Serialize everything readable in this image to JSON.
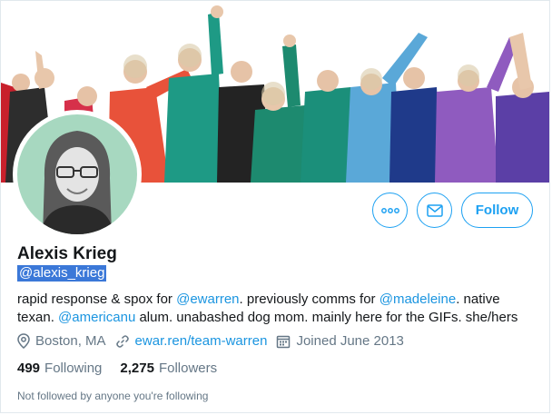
{
  "profile": {
    "name": "Alexis Krieg",
    "handle": "@alexis_krieg",
    "bio": {
      "t1": "rapid response & spox for ",
      "m1": "@ewarren",
      "t2": ". previously comms for ",
      "m2": "@madeleine",
      "t3": ". native texan. ",
      "m3": "@americanu",
      "t4": " alum. unabashed dog mom. mainly here for the GIFs. she/hers"
    },
    "location": "Boston, MA",
    "website": "ewar.ren/team-warren",
    "joined": "Joined June 2013",
    "following_count": "499",
    "following_label": "Following",
    "followers_count": "2,275",
    "followers_label": "Followers",
    "followed_by_note": "Not followed by anyone you're following"
  },
  "actions": {
    "follow_label": "Follow",
    "more_icon": "more-icon",
    "message_icon": "envelope-icon"
  },
  "colors": {
    "accent": "#1da1f2",
    "link": "#1b95e0",
    "muted": "#657786",
    "avatar_bg": "#a7d8c0",
    "handle_highlight": "#3b78d8"
  }
}
